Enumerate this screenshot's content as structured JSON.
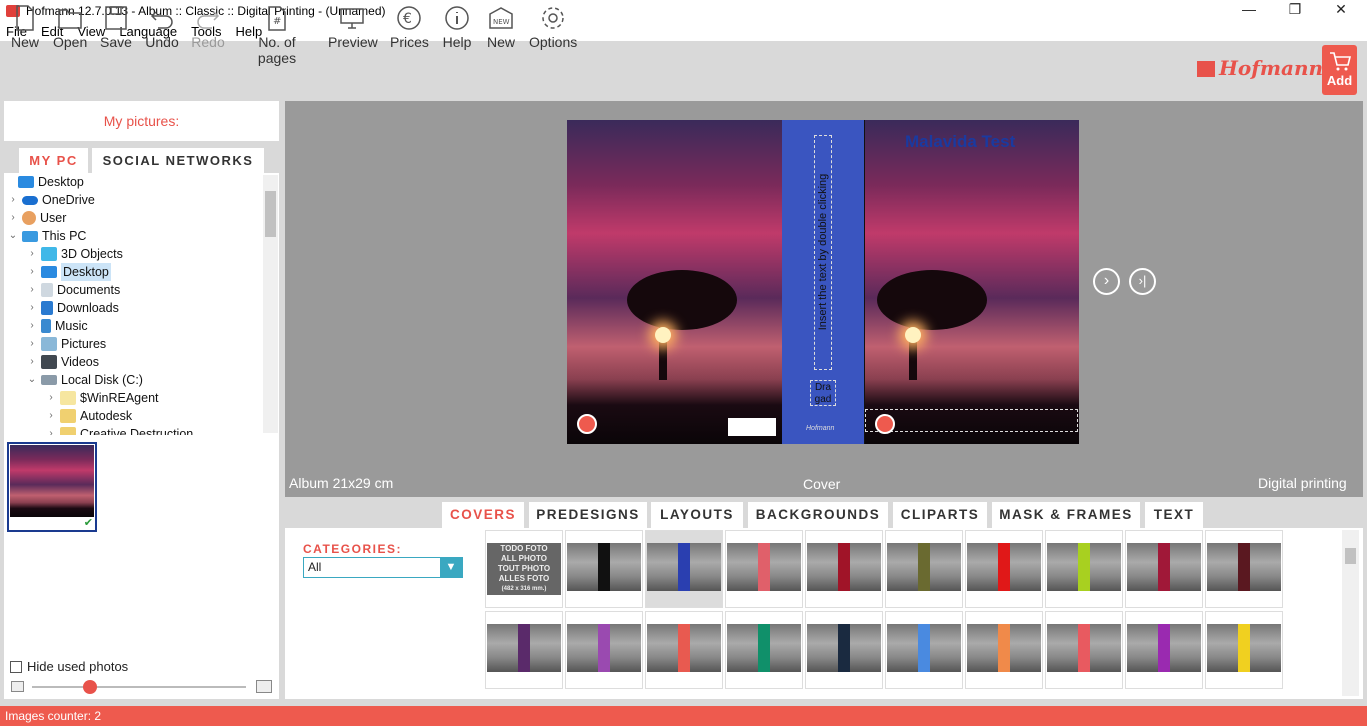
{
  "window": {
    "title": "Hofmann 12.7.0.13   -   Album :: Classic :: Digital Printing   -   (Unnamed)",
    "controls": {
      "minimize": "—",
      "maximize": "❐",
      "close": "✕"
    }
  },
  "menu": [
    "File",
    "Edit",
    "View",
    "Language",
    "Tools",
    "Help"
  ],
  "toolbar": {
    "new": "New",
    "open": "Open",
    "save": "Save",
    "undo": "Undo",
    "redo": "Redo",
    "pages": "No. of pages",
    "preview": "Preview",
    "prices": "Prices",
    "help": "Help",
    "new2": "New",
    "options": "Options",
    "new_badge": "NEW"
  },
  "brand": {
    "logo": "Hofmann",
    "add": "Add"
  },
  "left": {
    "title": "My pictures:",
    "tabs": [
      "MY PC",
      "SOCIAL NETWORKS"
    ],
    "tree": [
      {
        "label": "Desktop",
        "icon": "desktop-icon"
      },
      {
        "label": "OneDrive",
        "icon": "cloud-icon"
      },
      {
        "label": "User",
        "icon": "user-icon"
      },
      {
        "label": "This PC",
        "icon": "computer-icon"
      },
      {
        "label": "3D Objects",
        "icon": "cube-icon"
      },
      {
        "label": "Desktop",
        "icon": "desktop-icon"
      },
      {
        "label": "Documents",
        "icon": "document-icon"
      },
      {
        "label": "Downloads",
        "icon": "download-icon"
      },
      {
        "label": "Music",
        "icon": "music-icon"
      },
      {
        "label": "Pictures",
        "icon": "pictures-icon"
      },
      {
        "label": "Videos",
        "icon": "video-icon"
      },
      {
        "label": "Local Disk (C:)",
        "icon": "drive-icon"
      },
      {
        "label": "$WinREAgent",
        "icon": "folder-icon"
      },
      {
        "label": "Autodesk",
        "icon": "folder-icon"
      },
      {
        "label": "Creative Destruction",
        "icon": "folder-icon"
      }
    ],
    "hide_used": "Hide used photos",
    "slider_value": 0.25
  },
  "canvas": {
    "album_size": "Album 21x29 cm",
    "page_label": "Cover",
    "print_type": "Digital printing",
    "spine_text": "Insert the text by double clicking",
    "spine_small": "Dra gad",
    "cover_title": "Malavida Test",
    "spine_brand": "Hofmann"
  },
  "bottom": {
    "tabs": [
      "COVERS",
      "PREDESIGNS",
      "LAYOUTS",
      "BACKGROUNDS",
      "CLIPARTS",
      "MASK & FRAMES",
      "TEXT"
    ],
    "categories_label": "CATEGORIES:",
    "category_value": "All",
    "first_tile_text": [
      "TODO FOTO",
      "ALL PHOTO",
      "TOUT PHOTO",
      "ALLES FOTO",
      "(482 x 316 mm.)"
    ],
    "spine_colors_row1": [
      "#111111",
      "#2a3fb0",
      "#e0606a",
      "#a01428",
      "#6a6a30",
      "#e01818",
      "#a8d020",
      "#a01838",
      "#5a1820"
    ],
    "spine_colors_row2": [
      "#5a2a6a",
      "#9a4ab0",
      "#e85a50",
      "#10906a",
      "#1a2a40",
      "#4a8ae0",
      "#f08a4a",
      "#e85a60",
      "#9a2ab0",
      "#f0d020"
    ]
  },
  "status": {
    "images_counter": "Images counter: 2"
  },
  "colors": {
    "accent": "#ee5a4e",
    "spine_blue": "#3a55c0",
    "select_teal": "#3aa8c1"
  }
}
